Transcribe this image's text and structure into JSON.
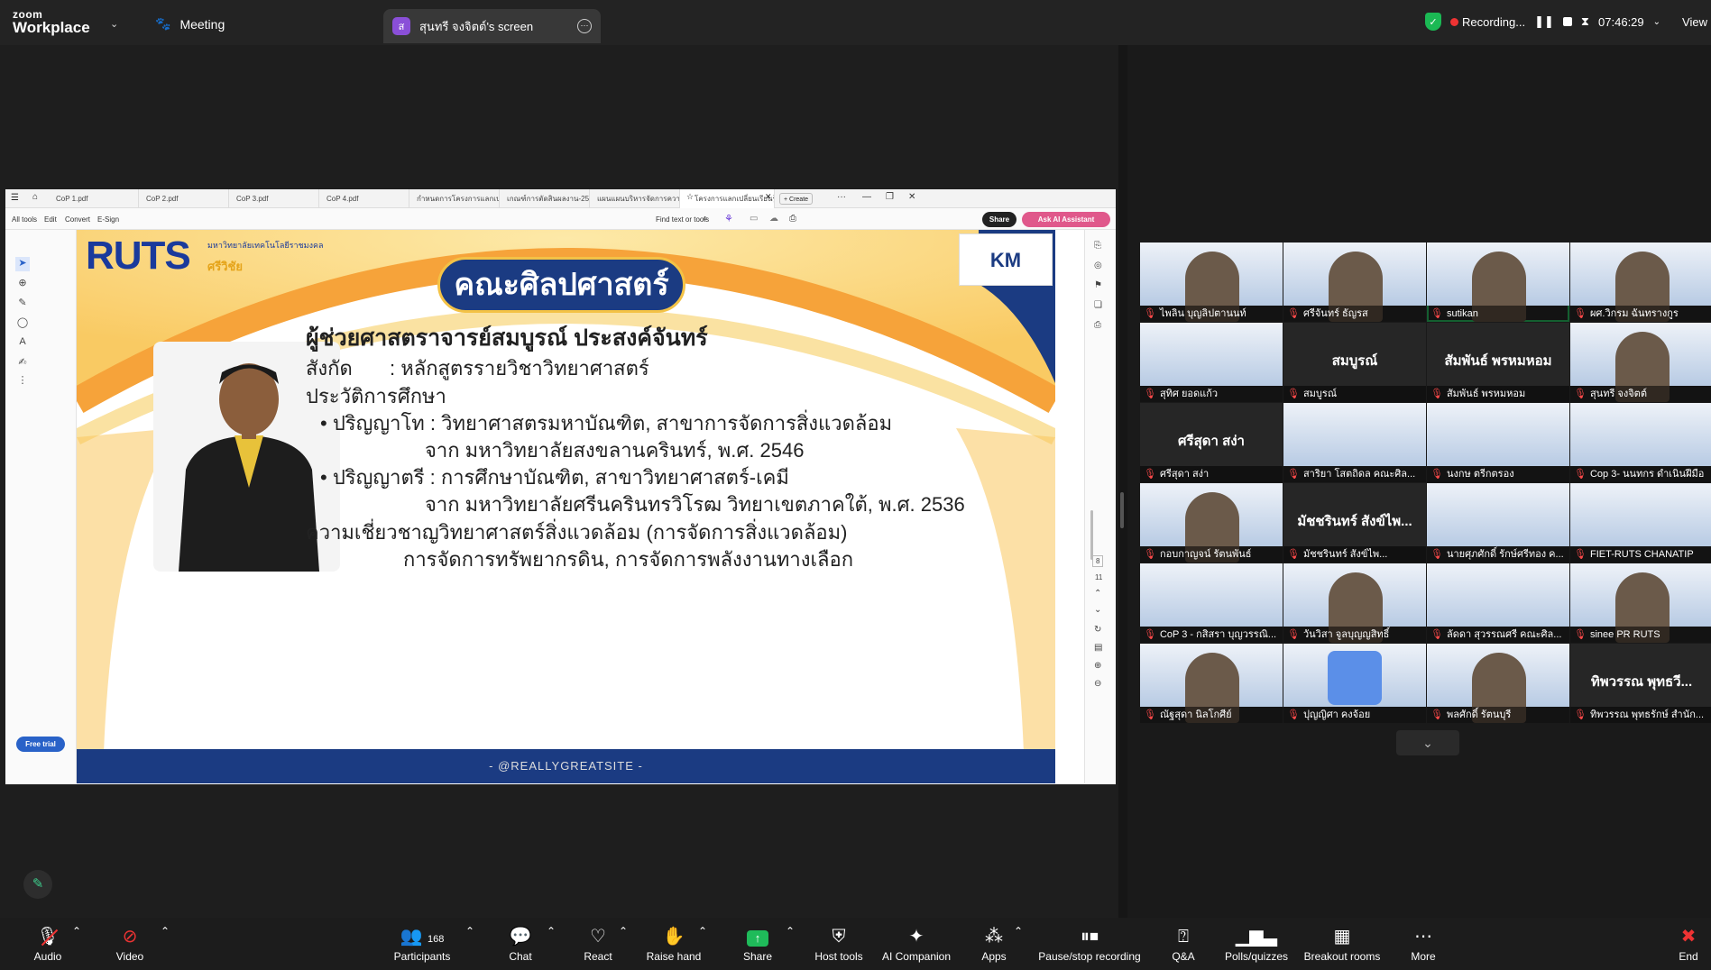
{
  "app": {
    "brand_top": "zoom",
    "brand_bottom": "Workplace",
    "meeting_label": "Meeting"
  },
  "screen_tab": {
    "avatar_letter": "ส",
    "label": "สุนทรี จงจิตต์'s screen"
  },
  "recording": {
    "label": "Recording...",
    "time": "07:46:29",
    "view_label": "View"
  },
  "pdf": {
    "tabs": [
      "CoP 1.pdf",
      "CoP 2.pdf",
      "CoP 3.pdf",
      "CoP 4.pdf",
      "กำหนดการโครงการแลกเปลี่ยนเรียน...",
      "เกณฑ์การตัดสินผลงาน-2569-257...",
      "แผนแผนบริหารจัดการความรู้-KM-2...",
      "โครงการแลกเปลี่ยนเรียนรู้แนว..."
    ],
    "create_label": "+ Create",
    "toolbar": {
      "all_tools": "All tools",
      "edit": "Edit",
      "convert": "Convert",
      "esign": "E-Sign",
      "find": "Find text or tools",
      "share": "Share",
      "ai": "Ask AI Assistant"
    },
    "free_trial": "Free trial",
    "page_number": "8",
    "page_total": "11"
  },
  "slide": {
    "logo_main": "RUTS",
    "logo_sub_small": "มหาวิทยาลัยเทคโนโลยีราชมงคล",
    "logo_sub": "ศรีวิชัย",
    "title": "คณะศิลปศาสตร์",
    "km_logo": "KM",
    "name": "ผู้ช่วยศาสตราจารย์สมบูรณ์ ประสงค์จันทร์",
    "affiliation_label": "สังกัด",
    "affiliation": ": หลักสูตรรายวิชาวิทยาศาสตร์",
    "edu_label": "ประวัติการศึกษา",
    "edu1_a": "•  ปริญญาโท : วิทยาศาสตรมหาบัณฑิต, สาขาการจัดการสิ่งแวดล้อม",
    "edu1_b": "จาก มหาวิทยาลัยสงขลานครินทร์, พ.ศ. 2546",
    "edu2_a": "•  ปริญญาตรี : การศึกษาบัณฑิต, สาขาวิทยาศาสตร์-เคมี",
    "edu2_b": "จาก มหาวิทยาลัยศรีนครินทรวิโรฒ วิทยาเขตภาคใต้, พ.ศ. 2536",
    "exp_label": "ความเชี่ยวชาญ",
    "exp_a": ": วิทยาศาสตร์สิ่งแวดล้อม (การจัดการสิ่งแวดล้อม)",
    "exp_b": "การจัดการทรัพยากรดิน, การจัดการพลังงานทางเลือก",
    "footer": "- @REALLYGREATSITE -"
  },
  "participants": [
    {
      "name": "ไพลิน บุญลิปตานนท์",
      "type": "cam"
    },
    {
      "name": "ศรีจันทร์ ธัญรส",
      "type": "cam"
    },
    {
      "name": "sutikan",
      "type": "cam",
      "highlight": true
    },
    {
      "name": "ผศ.วิกรม ฉันทรางกูร",
      "type": "cam"
    },
    {
      "name": "สุทิศ ยอดแก้ว",
      "type": "banner"
    },
    {
      "name": "สมบูรณ์",
      "type": "dark",
      "big": "สมบูรณ์"
    },
    {
      "name": "สัมพันธ์ พรหมหอม",
      "type": "dark",
      "big": "สัมพันธ์ พรหมหอม"
    },
    {
      "name": "สุนทรี จงจิตต์",
      "type": "cam"
    },
    {
      "name": "ศรีสุดา สง่า",
      "type": "dark",
      "big": "ศรีสุดา สง่า"
    },
    {
      "name": "สาริยา โสตถิดล คณะศิล...",
      "type": "banner"
    },
    {
      "name": "นงกษ ตรีกตรอง",
      "type": "banner"
    },
    {
      "name": "Cop 3- นนทกร ดำเนินฝีมือ",
      "type": "banner"
    },
    {
      "name": "กอบกาญจน์ รัตนพันธ์",
      "type": "cam"
    },
    {
      "name": "มัชชรินทร์ สังข์ไพ...",
      "type": "dark",
      "big": "มัชชรินทร์ สังข์ไพ..."
    },
    {
      "name": "นายศุภศักดิ์ รักษ์ศรีทอง ค...",
      "type": "banner"
    },
    {
      "name": "FIET-RUTS CHANATIP",
      "type": "banner"
    },
    {
      "name": "CoP 3 - กสิสรา บุญวรรณิ...",
      "type": "banner"
    },
    {
      "name": "วันวิสา จูลบุญญสิทธิ์",
      "type": "cam"
    },
    {
      "name": "ลัดดา สุวรรณศรี คณะศิล...",
      "type": "banner"
    },
    {
      "name": "sinee PR RUTS",
      "type": "cam"
    },
    {
      "name": "ณัฐสุดา นิลโกศีย์",
      "type": "cam"
    },
    {
      "name": "ปุญญิศา คงจ้อย",
      "type": "avatar"
    },
    {
      "name": "พลศักดิ์ รัตนบุรี",
      "type": "cam"
    },
    {
      "name": "ทิพวรรณ พุทธรักษ์ สำนัก...",
      "type": "dark",
      "big": "ทิพวรรณ พุทธวี..."
    }
  ],
  "bottombar": {
    "audio": "Audio",
    "video": "Video",
    "participants": "Participants",
    "participants_count": "168",
    "chat": "Chat",
    "react": "React",
    "raise_hand": "Raise hand",
    "share": "Share",
    "host_tools": "Host tools",
    "ai_companion": "AI Companion",
    "apps": "Apps",
    "pause_stop": "Pause/stop recording",
    "qa": "Q&A",
    "polls": "Polls/quizzes",
    "breakout": "Breakout rooms",
    "more": "More",
    "end": "End"
  }
}
